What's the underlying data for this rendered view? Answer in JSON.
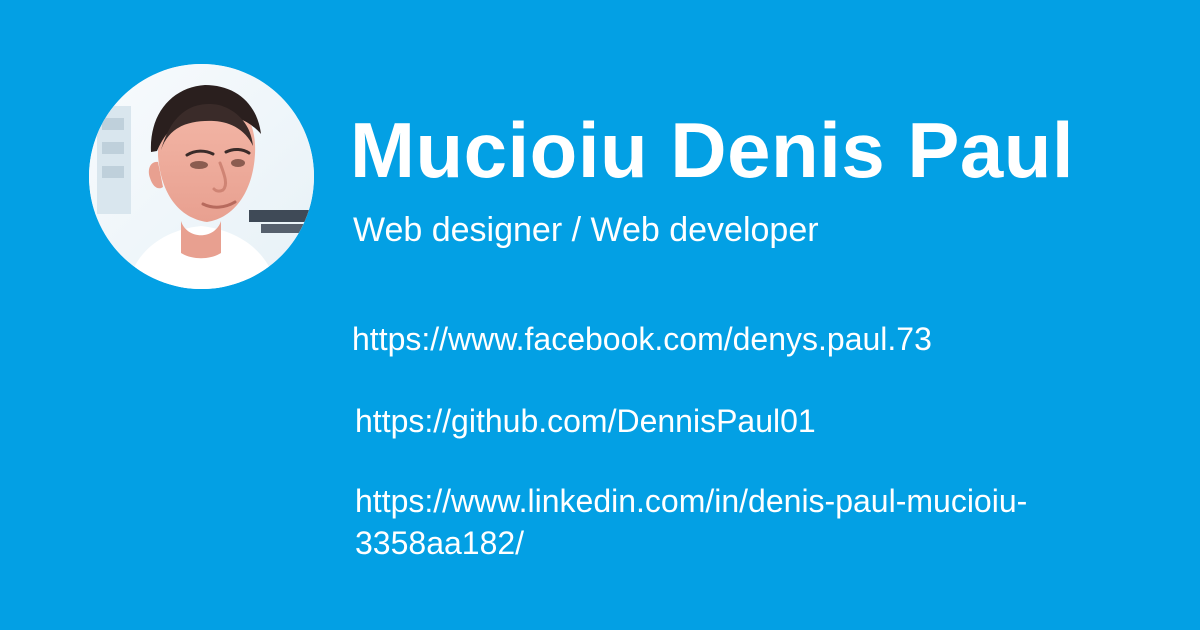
{
  "profile": {
    "name": "Mucioiu Denis Paul",
    "role": "Web designer / Web developer"
  },
  "links": {
    "facebook": "https://www.facebook.com/denys.paul.73",
    "github": "https://github.com/DennisPaul01",
    "linkedin": "https://www.linkedin.com/in/denis-paul-mucioiu-3358aa182/"
  },
  "colors": {
    "background": "#03a0e4",
    "text": "#ffffff"
  },
  "icons": {
    "avatar": "profile-photo"
  }
}
